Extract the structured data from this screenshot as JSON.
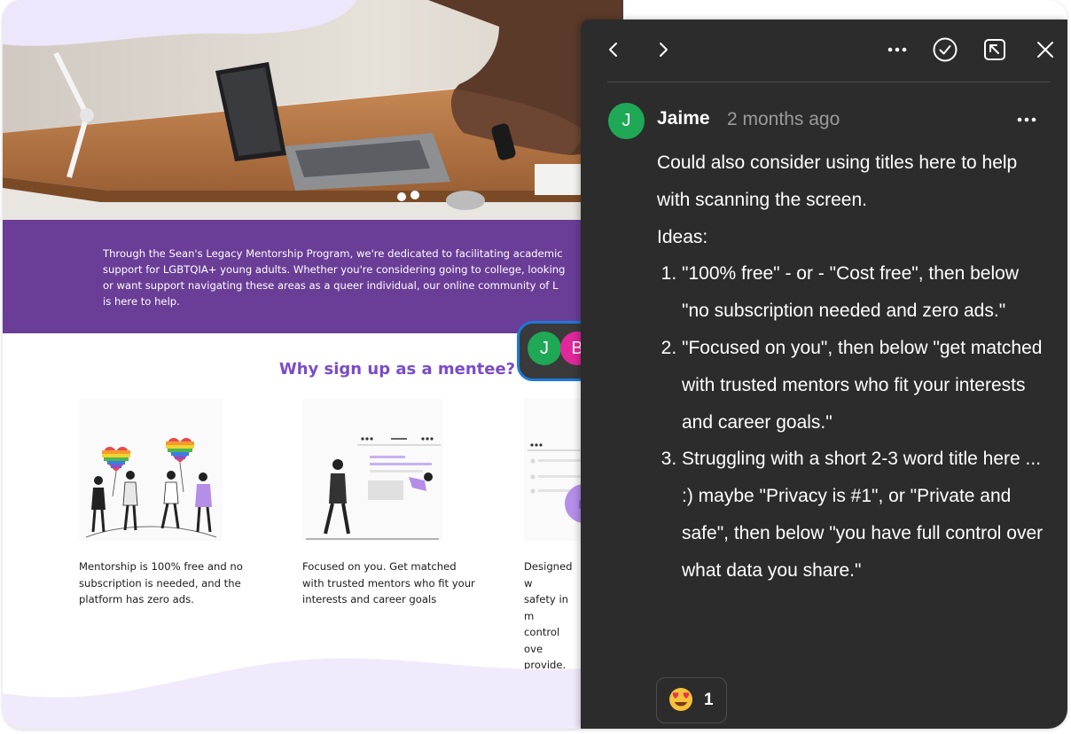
{
  "design": {
    "intro_text": "Through the Sean's Legacy Mentorship Program, we're dedicated to facilitating academic\nsupport for LGBTQIA+ young adults. Whether you're considering going to college, looking\nor want support navigating these areas as a queer individual, our online community of L\nis here to help.",
    "section_title": "Why sign up as a mentee?",
    "features": [
      {
        "text": "Mentorship is 100% free and no\nsubscription is needed, and the\nplatform has zero ads."
      },
      {
        "text": "Focused on you. Get matched\nwith trusted mentors who fit your\ninterests and career goals"
      },
      {
        "text": "Designed w\nsafety in m\ncontrol ove\nprovide."
      }
    ]
  },
  "collaborators": [
    {
      "initial": "J",
      "color": "#1fa855"
    },
    {
      "initial": "B",
      "color": "#e0279b"
    }
  ],
  "comment": {
    "author_initial": "J",
    "author": "Jaime",
    "time": "2 months ago",
    "intro_line": "Could also consider using titles here to help with scanning the screen.",
    "ideas_label": "Ideas:",
    "ideas": [
      "\"100% free\"  - or - \"Cost free\", then below \"no subscription needed and zero ads.\"",
      "\"Focused on you\", then below \"get matched with trusted mentors who fit your interests and career goals.\"",
      "Struggling with a short 2-3 word title here ... :) maybe \"Privacy is #1\", or \"Private and safe\", then below \"you have full control over what data you share.\""
    ],
    "reaction": {
      "emoji": "heart-eyes-emoji",
      "count": "1"
    }
  },
  "toolbar_icons": [
    "chevron-left-icon",
    "chevron-right-icon",
    "more-icon",
    "resolve-check-icon",
    "open-external-icon",
    "close-icon"
  ],
  "colors": {
    "panel_bg": "#2c2c2c",
    "purple_band": "#6a3d97",
    "title_purple": "#7a4bc9",
    "lavender": "#eee6fb",
    "avatar_green": "#1fa855",
    "avatar_pink": "#e0279b",
    "selection_blue": "#1f7ad8"
  }
}
